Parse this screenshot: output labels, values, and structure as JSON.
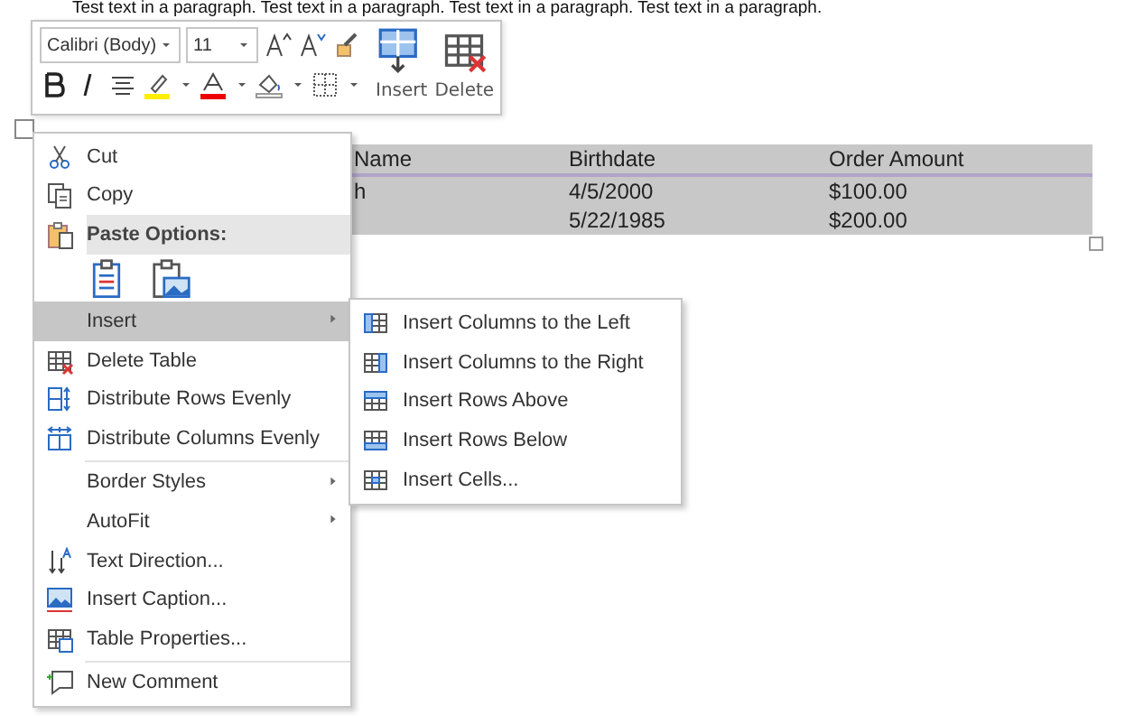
{
  "paragraph": "Test text in a paragraph. Test text in a paragraph. Test text in a paragraph. Test text in a paragraph.",
  "mini_toolbar": {
    "font": "Calibri (Body)",
    "size": "11",
    "insert_label": "Insert",
    "delete_label": "Delete"
  },
  "table": {
    "columns": [
      "Name",
      "Birthdate",
      "Order Amount"
    ],
    "rows": [
      {
        "column_1": "h",
        "birthdate": "4/5/2000",
        "order_amount": "$100.00"
      },
      {
        "birthdate": "5/22/1985",
        "order_amount": "$200.00"
      }
    ]
  },
  "context_menu": {
    "items": [
      {
        "kind": "item",
        "label": "Cut",
        "selected": false,
        "has_submenu": false
      },
      {
        "kind": "item",
        "label": "Copy",
        "selected": false,
        "has_submenu": false
      },
      {
        "kind": "header",
        "label": "Paste Options:"
      },
      {
        "kind": "paste_icons"
      },
      {
        "kind": "item",
        "label": "Insert",
        "selected": true,
        "has_submenu": true
      },
      {
        "kind": "item",
        "label": "Delete Table",
        "selected": false,
        "has_submenu": false
      },
      {
        "kind": "item",
        "label": "Distribute Rows Evenly",
        "selected": false,
        "has_submenu": false
      },
      {
        "kind": "item",
        "label": "Distribute Columns Evenly",
        "selected": false,
        "has_submenu": false
      },
      {
        "kind": "separator"
      },
      {
        "kind": "item",
        "label": "Border Styles",
        "selected": false,
        "has_submenu": true
      },
      {
        "kind": "item",
        "label": "AutoFit",
        "selected": false,
        "has_submenu": true
      },
      {
        "kind": "item",
        "label": "Text Direction...",
        "selected": false,
        "has_submenu": false
      },
      {
        "kind": "item",
        "label": "Insert Caption...",
        "selected": false,
        "has_submenu": false
      },
      {
        "kind": "item",
        "label": "Table Properties...",
        "selected": false,
        "has_submenu": false
      },
      {
        "kind": "separator"
      },
      {
        "kind": "item",
        "label": "New Comment",
        "selected": false,
        "has_submenu": false
      }
    ]
  },
  "submenu": {
    "items": [
      {
        "label": "Insert Columns to the Left",
        "selected": false
      },
      {
        "label": "Insert Columns to the Right",
        "selected": false
      },
      {
        "label": "Insert Rows Above",
        "selected": false
      },
      {
        "label": "Insert Rows Below",
        "selected": false
      },
      {
        "label": "Insert Cells...",
        "selected": false
      }
    ]
  }
}
